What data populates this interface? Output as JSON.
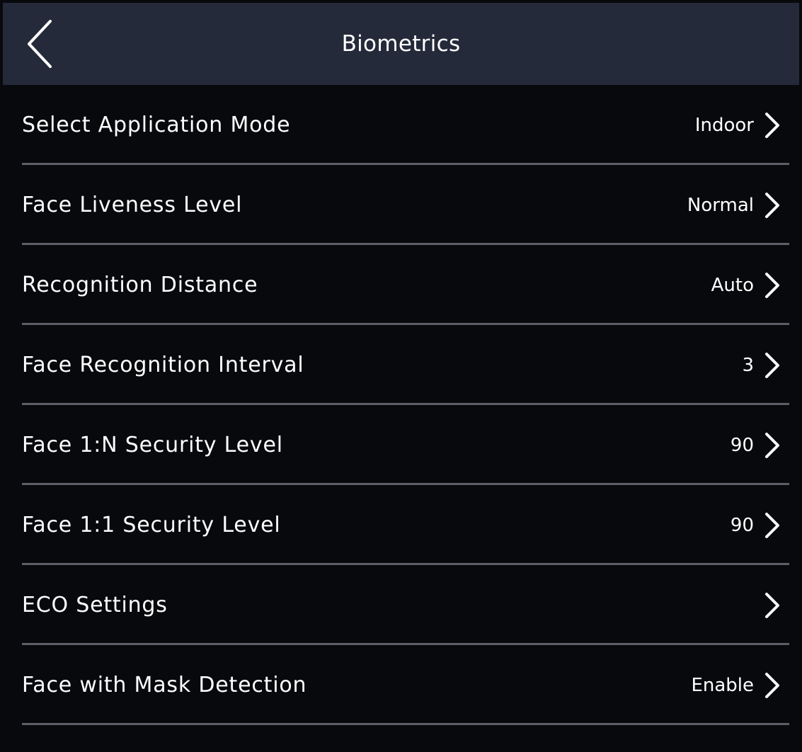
{
  "header": {
    "title": "Biometrics",
    "back_icon": "chevron-left-icon"
  },
  "settings": [
    {
      "label": "Select Application Mode",
      "value": "Indoor"
    },
    {
      "label": "Face Liveness Level",
      "value": "Normal"
    },
    {
      "label": "Recognition Distance",
      "value": "Auto"
    },
    {
      "label": "Face Recognition Interval",
      "value": "3"
    },
    {
      "label": "Face 1:N Security Level",
      "value": "90"
    },
    {
      "label": "Face 1:1 Security Level",
      "value": "90"
    },
    {
      "label": "ECO Settings",
      "value": ""
    },
    {
      "label": "Face with Mask Detection",
      "value": "Enable"
    }
  ],
  "colors": {
    "header_background": "#252a3a",
    "page_background": "#08090d",
    "divider": "#5c5f66",
    "text": "#ffffff"
  }
}
